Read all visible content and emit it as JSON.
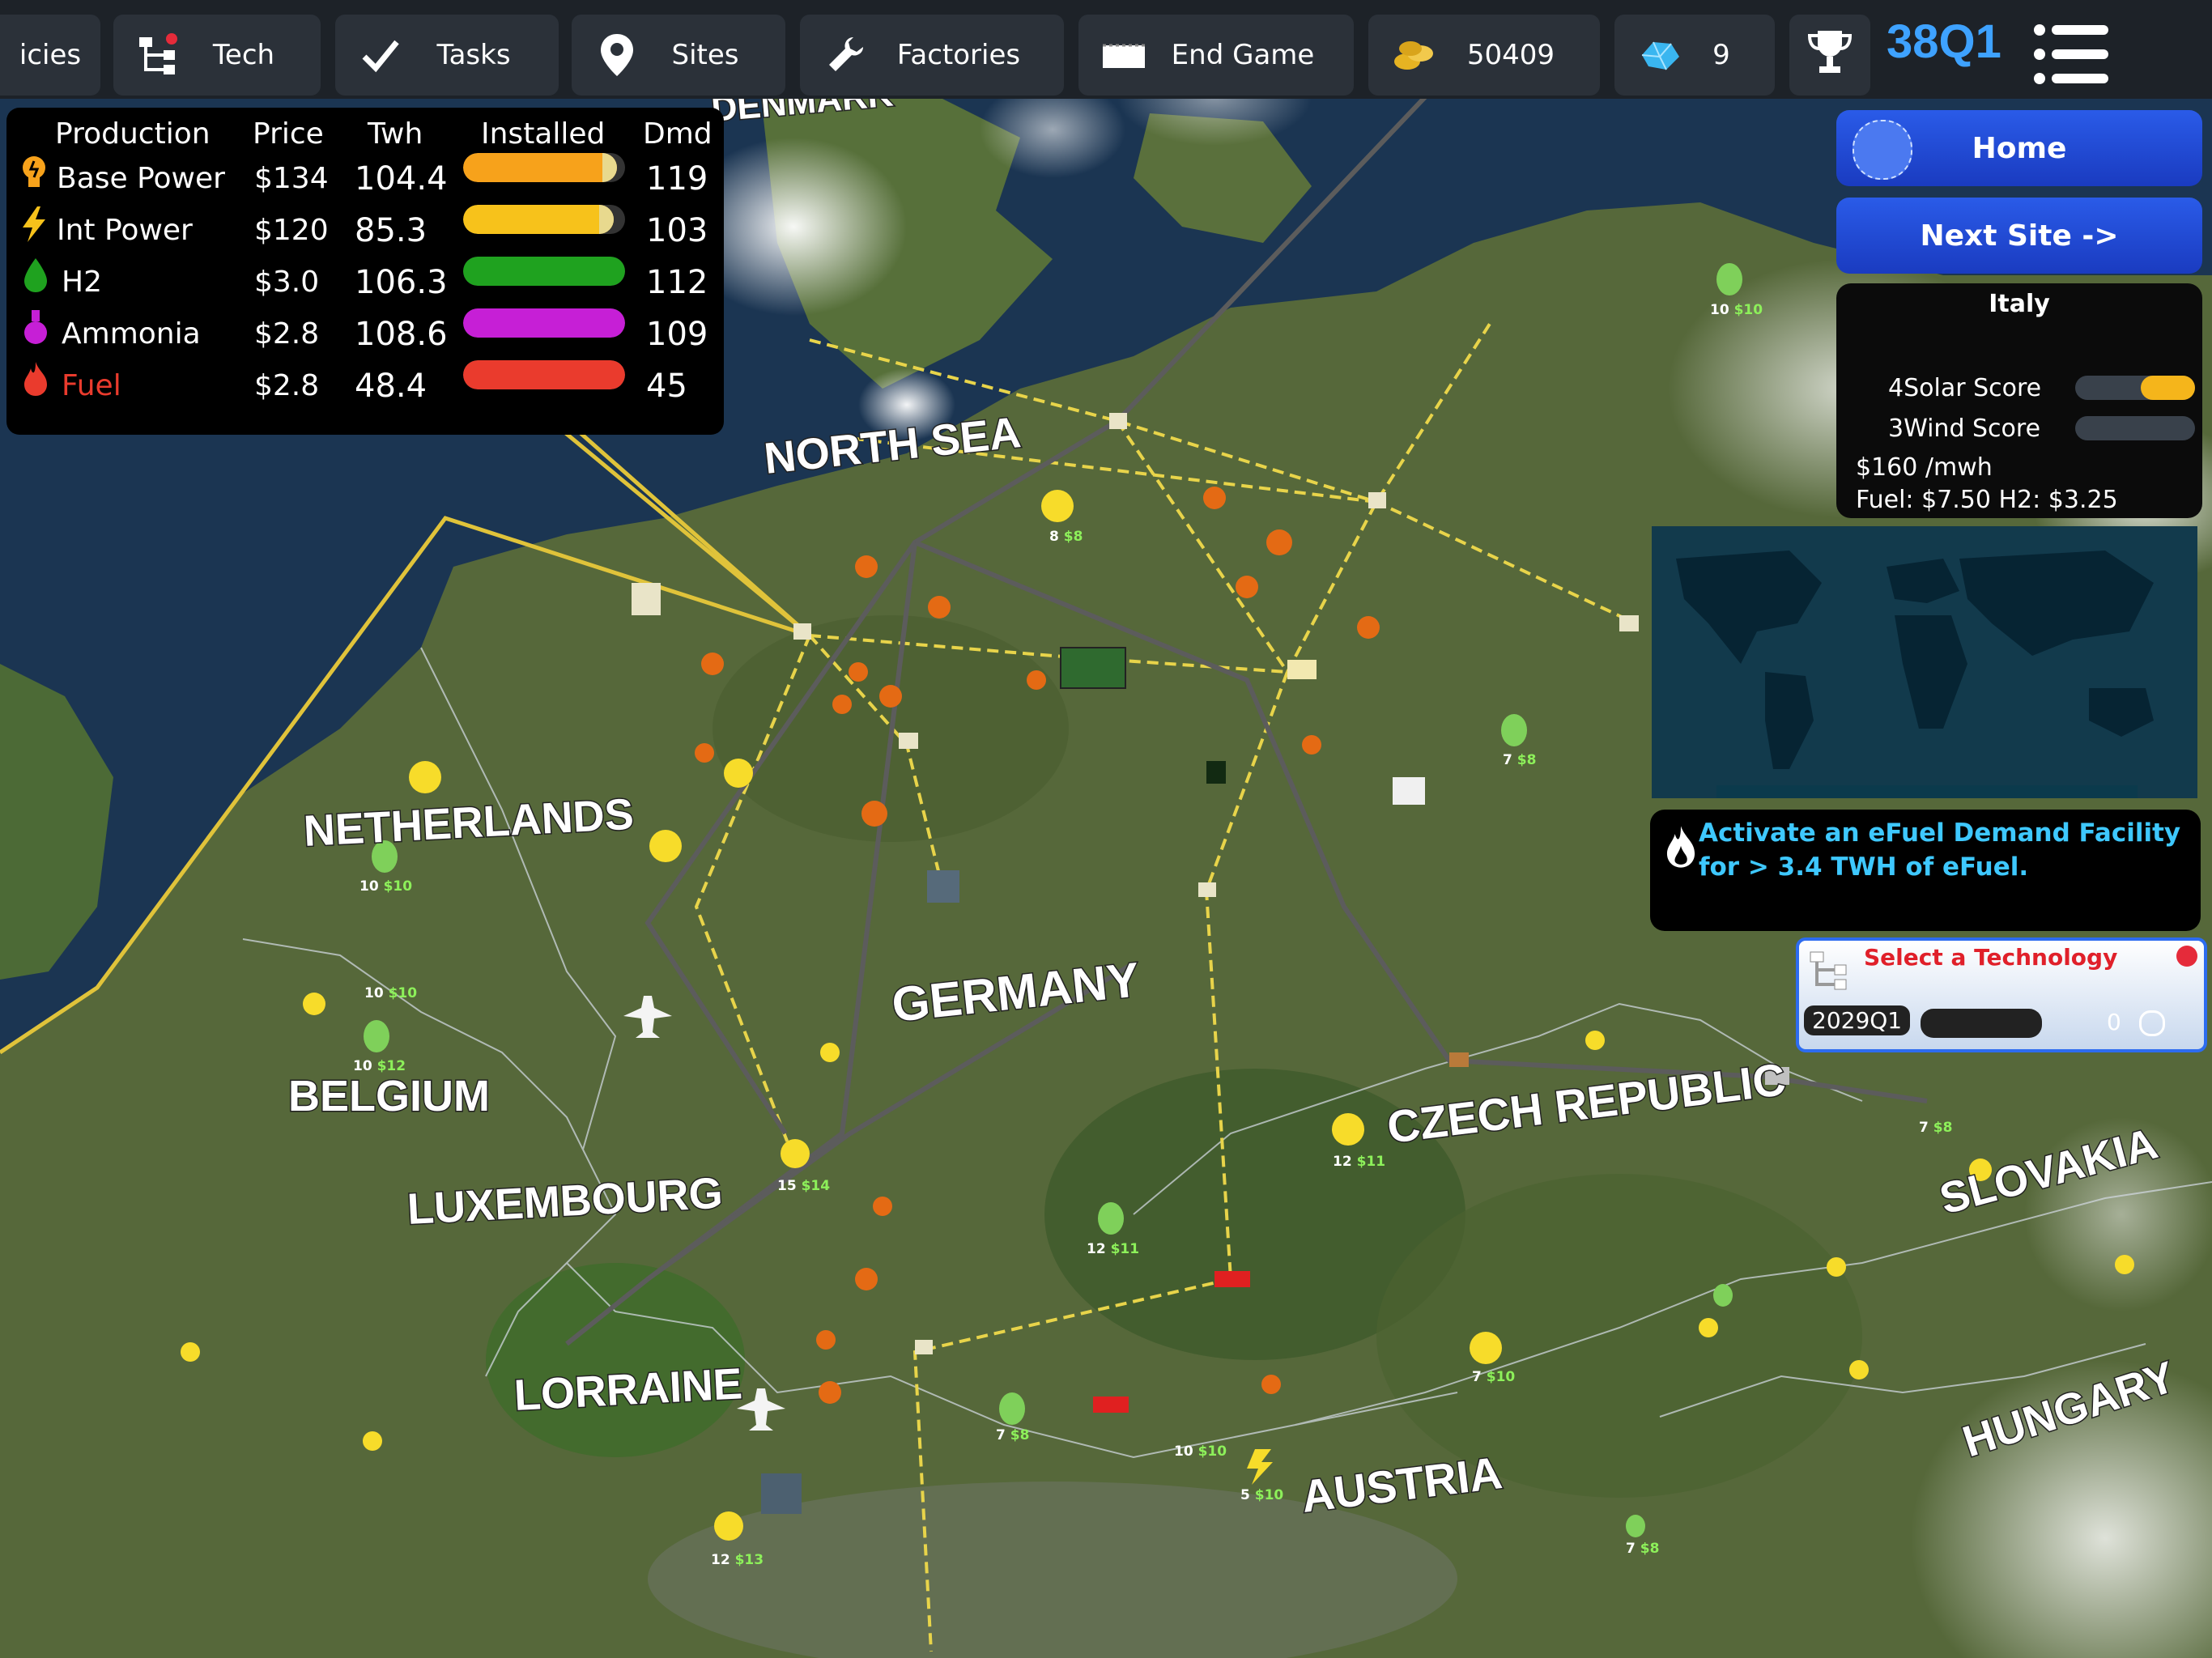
{
  "topbar": {
    "policies": "icies",
    "tech": "Tech",
    "tasks": "Tasks",
    "sites": "Sites",
    "factories": "Factories",
    "end_game": "End Game",
    "money": "50409",
    "crystals": "9",
    "quarter": "38Q1"
  },
  "production": {
    "headers": [
      "Production",
      "Price",
      "Twh",
      "Installed",
      "Dmd"
    ],
    "rows": [
      {
        "name": "Base Power",
        "price": "$134",
        "twh": "104.4",
        "installed_fraction": 0.95,
        "dmd": "119",
        "color": "#f7a21b"
      },
      {
        "name": "Int Power",
        "price": "$120",
        "twh": "85.3",
        "installed_fraction": 0.93,
        "dmd": "103",
        "color": "#f7c21b"
      },
      {
        "name": "H2",
        "price": "$3.0",
        "twh": "106.3",
        "installed_fraction": 1.0,
        "dmd": "112",
        "color": "#1fa21f"
      },
      {
        "name": "Ammonia",
        "price": "$2.8",
        "twh": "108.6",
        "installed_fraction": 1.0,
        "dmd": "109",
        "color": "#c61fd6"
      },
      {
        "name": "Fuel",
        "price": "$2.8",
        "twh": "48.4",
        "installed_fraction": 1.0,
        "dmd": "45",
        "color": "#ea3b2d"
      }
    ]
  },
  "nav": {
    "home": "Home",
    "next_site": "Next Site ->"
  },
  "site": {
    "name": "Italy",
    "solar_label": "4Solar Score",
    "solar_fraction": 0.45,
    "wind_label": "3Wind Score",
    "wind_fraction": 0.0,
    "price": "$160 /mwh",
    "fuel_h2": "Fuel: $7.50 H2: $3.25"
  },
  "task": {
    "text": "Activate an eFuel Demand Facility for > 3.4 TWH of eFuel."
  },
  "tech_panel": {
    "title": "Select a Technology",
    "date": "2029Q1",
    "count": "0"
  },
  "map": {
    "countries": [
      "NORTH SEA",
      "NETHERLANDS",
      "BELGIUM",
      "LUXEMBOURG",
      "LORRAINE",
      "GERMANY",
      "CZECH REPUBLIC",
      "SLOVAKIA",
      "AUSTRIA",
      "HUNGARY",
      "DENMARK"
    ],
    "pins": [
      {
        "num": "10",
        "price": "$10"
      },
      {
        "num": "8",
        "price": "$8"
      },
      {
        "num": "7",
        "price": "$8"
      },
      {
        "num": "10",
        "price": "$10"
      },
      {
        "num": "10",
        "price": "$12"
      },
      {
        "num": "15",
        "price": "$14"
      },
      {
        "num": "12",
        "price": "$11"
      },
      {
        "num": "12",
        "price": "$11"
      },
      {
        "num": "7",
        "price": "$10"
      },
      {
        "num": "7",
        "price": "$8"
      },
      {
        "num": "5",
        "price": "$10"
      },
      {
        "num": "10",
        "price": "$10"
      },
      {
        "num": "12",
        "price": "$13"
      },
      {
        "num": "10",
        "price": "$10"
      },
      {
        "num": "7",
        "price": "$8"
      },
      {
        "num": "7",
        "price": "$8"
      }
    ]
  },
  "colors": {
    "topbar_bg": "#1d2228",
    "button_bg": "#2b3139",
    "accent_blue": "#3ea2ff",
    "task_text": "#3ec8ff",
    "tech_title": "#e0202a"
  }
}
